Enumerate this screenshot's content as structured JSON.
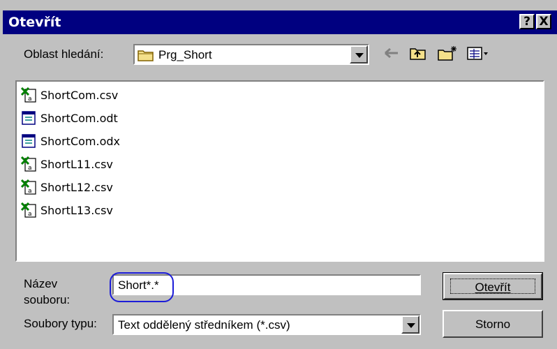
{
  "window": {
    "title": "Otevřít",
    "help_label": "?",
    "close_label": "X"
  },
  "lookin": {
    "label": "Oblast hledání:",
    "value": "Prg_Short"
  },
  "files": [
    {
      "name": "ShortCom.csv",
      "icon": "excel-csv-icon"
    },
    {
      "name": "ShortCom.odt",
      "icon": "data-file-icon"
    },
    {
      "name": "ShortCom.odx",
      "icon": "data-file-icon"
    },
    {
      "name": "ShortL11.csv",
      "icon": "excel-csv-icon"
    },
    {
      "name": "ShortL12.csv",
      "icon": "excel-csv-icon"
    },
    {
      "name": "ShortL13.csv",
      "icon": "excel-csv-icon"
    }
  ],
  "filename": {
    "label_line1": "Název",
    "label_line2": "souboru:",
    "value": "Short*.*"
  },
  "filetype": {
    "label": "Soubory typu:",
    "value": "Text oddělený středníkem (*.csv)"
  },
  "buttons": {
    "open": "Otevřít",
    "cancel": "Storno"
  },
  "colors": {
    "titlebar": "#000080",
    "face": "#c0c0c0",
    "highlight_circle": "#1c1cd8"
  }
}
